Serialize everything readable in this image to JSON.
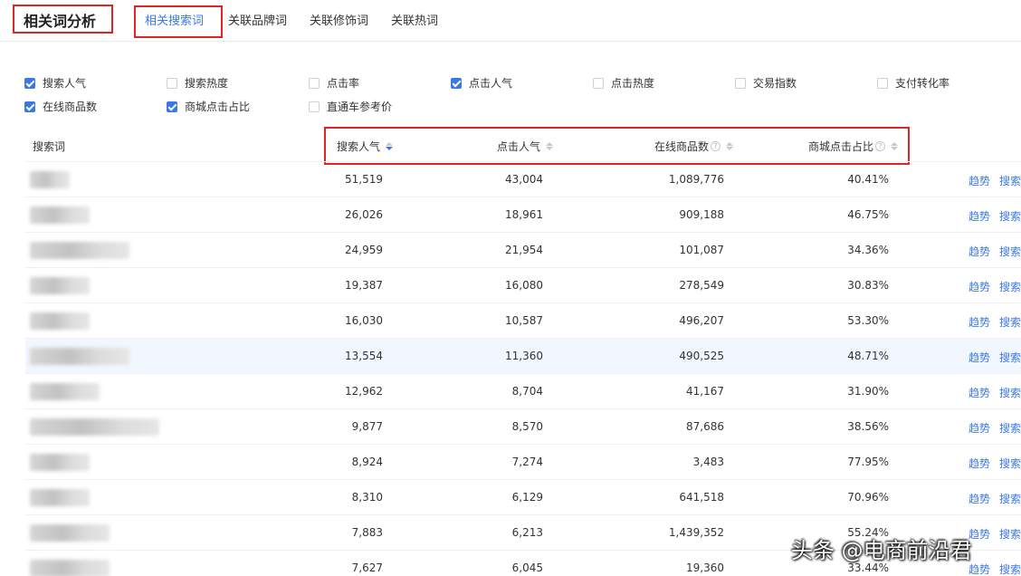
{
  "header": {
    "title": "相关词分析",
    "tabs": [
      {
        "label": "相关搜索词",
        "active": true
      },
      {
        "label": "关联品牌词",
        "active": false
      },
      {
        "label": "关联修饰词",
        "active": false
      },
      {
        "label": "关联热词",
        "active": false
      }
    ]
  },
  "filters": [
    {
      "label": "搜索人气",
      "checked": true
    },
    {
      "label": "搜索热度",
      "checked": false
    },
    {
      "label": "点击率",
      "checked": false
    },
    {
      "label": "点击人气",
      "checked": true
    },
    {
      "label": "点击热度",
      "checked": false
    },
    {
      "label": "交易指数",
      "checked": false
    },
    {
      "label": "支付转化率",
      "checked": false
    },
    {
      "label": "在线商品数",
      "checked": true
    },
    {
      "label": "商城点击占比",
      "checked": true
    },
    {
      "label": "直通车参考价",
      "checked": false
    }
  ],
  "table": {
    "columns": {
      "keyword": "搜索词",
      "search_popularity": "搜索人气",
      "click_popularity": "点击人气",
      "online_products": "在线商品数",
      "mall_click_ratio": "商城点击占比"
    },
    "help_glyph": "?",
    "actions": {
      "trend": "趋势",
      "search": "搜索"
    },
    "rows": [
      {
        "search": "51,519",
        "click": "43,004",
        "products": "1,089,776",
        "ratio": "40.41%"
      },
      {
        "search": "26,026",
        "click": "18,961",
        "products": "909,188",
        "ratio": "46.75%"
      },
      {
        "search": "24,959",
        "click": "21,954",
        "products": "101,087",
        "ratio": "34.36%"
      },
      {
        "search": "19,387",
        "click": "16,080",
        "products": "278,549",
        "ratio": "30.83%"
      },
      {
        "search": "16,030",
        "click": "10,587",
        "products": "496,207",
        "ratio": "53.30%"
      },
      {
        "search": "13,554",
        "click": "11,360",
        "products": "490,525",
        "ratio": "48.71%"
      },
      {
        "search": "12,962",
        "click": "8,704",
        "products": "41,167",
        "ratio": "31.90%"
      },
      {
        "search": "9,877",
        "click": "8,570",
        "products": "87,686",
        "ratio": "38.56%"
      },
      {
        "search": "8,924",
        "click": "7,274",
        "products": "3,483",
        "ratio": "77.95%"
      },
      {
        "search": "8,310",
        "click": "6,129",
        "products": "641,518",
        "ratio": "70.96%"
      },
      {
        "search": "7,883",
        "click": "6,213",
        "products": "1,439,352",
        "ratio": "55.24%"
      },
      {
        "search": "7,627",
        "click": "6,045",
        "products": "19,360",
        "ratio": "33.44%"
      }
    ]
  },
  "watermark": "头条 @电商前沿君",
  "colors": {
    "accent": "#3b78e7",
    "highlight_box": "#e02424",
    "hover_row": "#f2f7ff"
  }
}
